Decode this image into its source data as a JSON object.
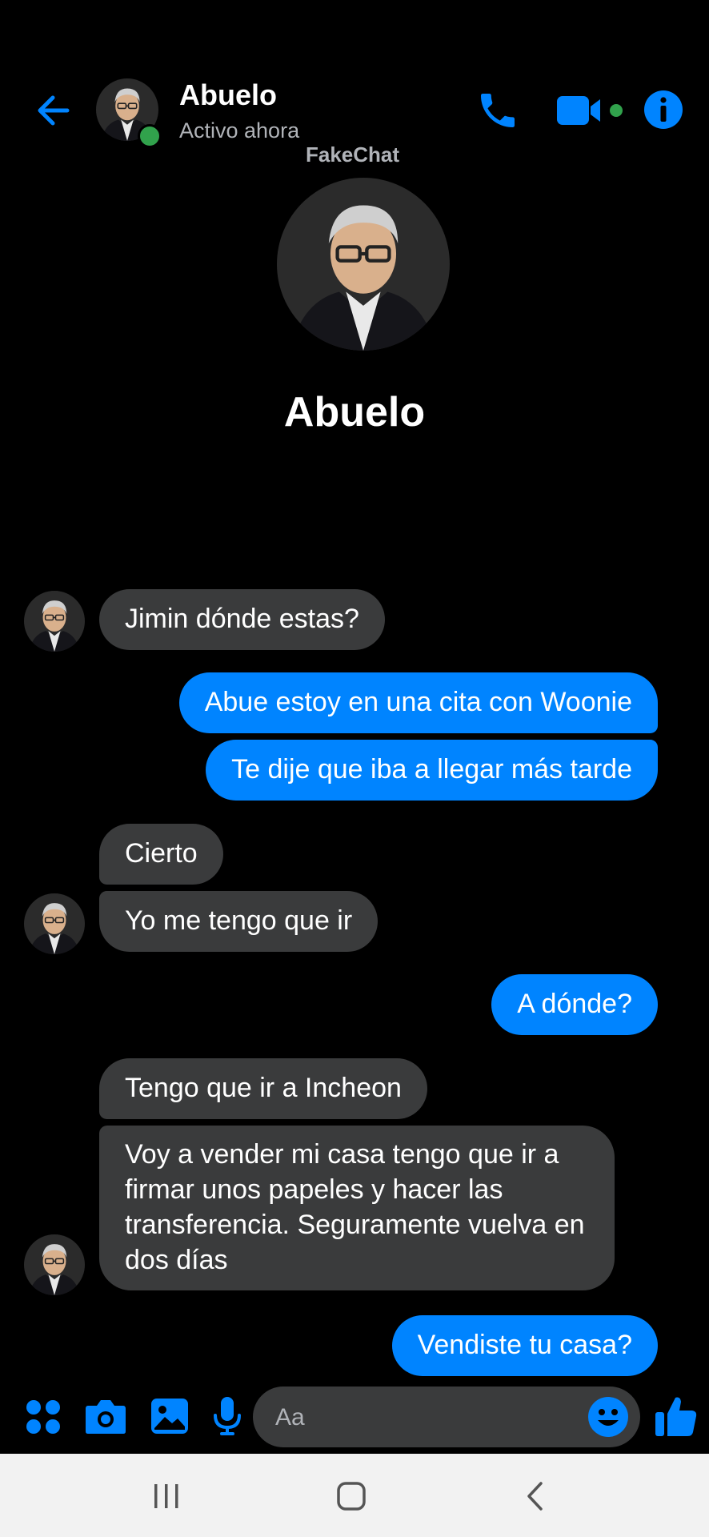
{
  "header": {
    "contact_name": "Abuelo",
    "status": "Activo ahora"
  },
  "watermark": "FakeChat",
  "profile": {
    "name": "Abuelo"
  },
  "messages": [
    {
      "sender": "contact",
      "text": "Jimin dónde estas?"
    },
    {
      "sender": "me",
      "text": "Abue estoy en una cita con Woonie"
    },
    {
      "sender": "me",
      "text": "Te dije que iba a llegar más tarde"
    },
    {
      "sender": "contact",
      "text": "Cierto"
    },
    {
      "sender": "contact",
      "text": "Yo me tengo que ir"
    },
    {
      "sender": "me",
      "text": "A dónde?"
    },
    {
      "sender": "contact",
      "text": "Tengo que ir a Incheon"
    },
    {
      "sender": "contact",
      "text": "Voy a vender mi casa tengo que ir a firmar unos papeles y hacer las transferencia. Seguramente vuelva en dos días"
    },
    {
      "sender": "me",
      "text": "Vendiste tu casa?"
    }
  ],
  "composer": {
    "placeholder": "Aa"
  },
  "colors": {
    "accent": "#0084ff",
    "received_bubble": "#3a3b3c",
    "online": "#31a24c",
    "background": "#000000"
  },
  "icons": {
    "header": [
      "back-arrow-icon",
      "phone-icon",
      "video-camera-icon",
      "info-icon"
    ],
    "composer": [
      "apps-icon",
      "camera-icon",
      "gallery-icon",
      "microphone-icon",
      "emoji-icon",
      "thumbs-up-icon"
    ],
    "navigation": [
      "recent-apps-icon",
      "home-icon",
      "back-icon"
    ]
  }
}
